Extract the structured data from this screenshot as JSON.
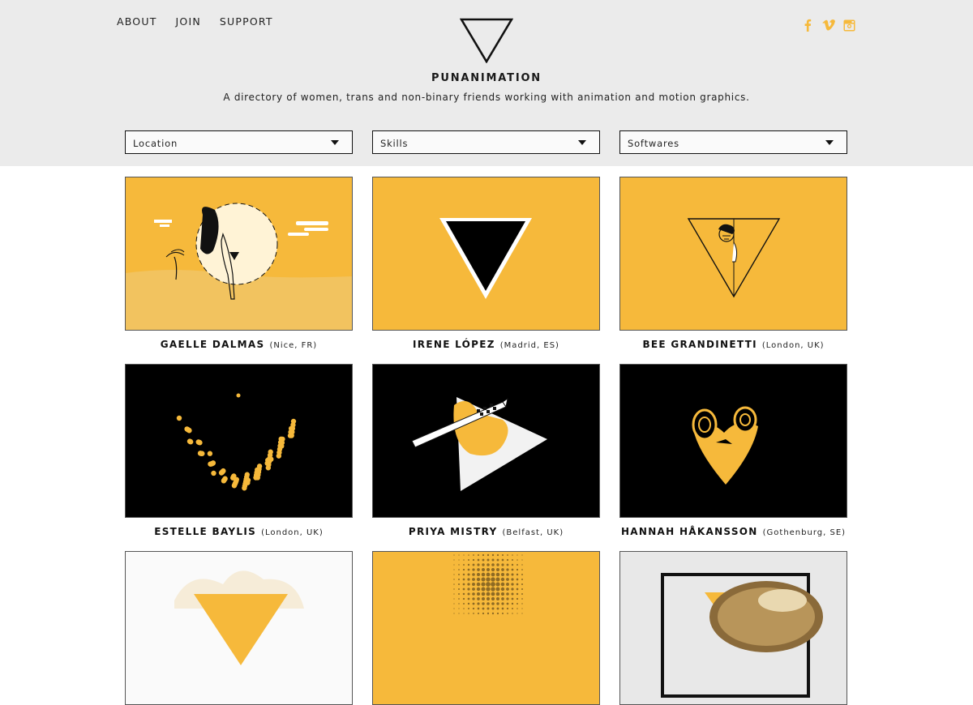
{
  "nav": {
    "about": "ABOUT",
    "join": "JOIN",
    "support": "SUPPORT"
  },
  "brand": {
    "name": "PUNANIMATION",
    "tagline": "A directory of women, trans and non-binary friends working with animation and motion graphics.",
    "accent": "#f6b93b"
  },
  "social": [
    "facebook-icon",
    "vimeo-icon",
    "instagram-icon"
  ],
  "filters": [
    {
      "label": "Location"
    },
    {
      "label": "Skills"
    },
    {
      "label": "Softwares"
    }
  ],
  "profiles": [
    {
      "name": "GAELLE DALMAS",
      "location": "(Nice, FR)"
    },
    {
      "name": "IRENE LÓPEZ",
      "location": "(Madrid, ES)"
    },
    {
      "name": "BEE GRANDINETTI",
      "location": "(London, UK)"
    },
    {
      "name": "ESTELLE BAYLIS",
      "location": "(London, UK)"
    },
    {
      "name": "PRIYA MISTRY",
      "location": "(Belfast, UK)"
    },
    {
      "name": "HANNAH HÅKANSSON",
      "location": "(Gothenburg, SE)"
    },
    {
      "name": "",
      "location": ""
    },
    {
      "name": "",
      "location": ""
    },
    {
      "name": "",
      "location": ""
    }
  ]
}
